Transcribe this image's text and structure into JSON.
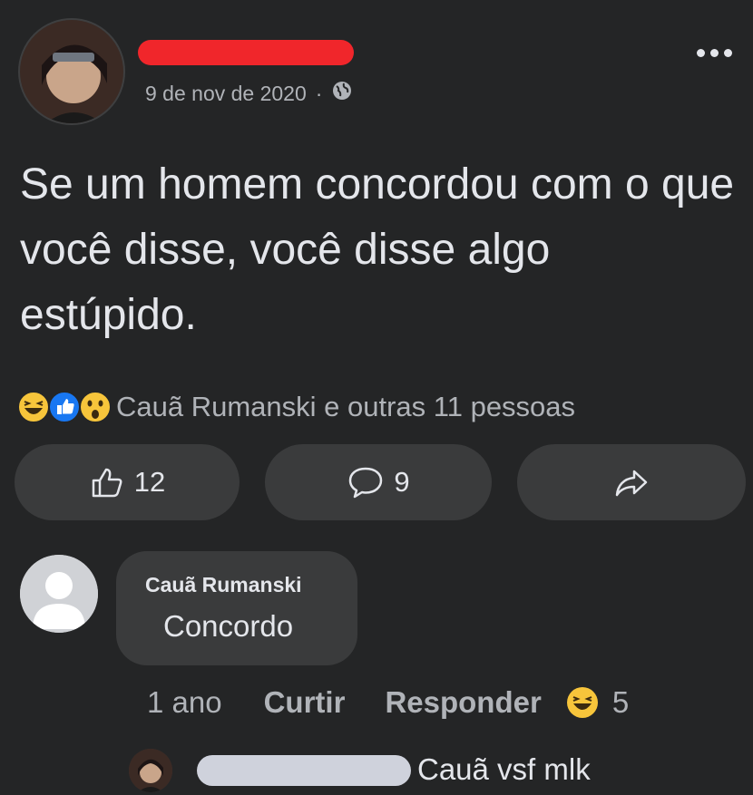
{
  "post": {
    "date": "9 de nov de 2020",
    "separator": "·",
    "privacy_icon": "globe-icon",
    "text": "Se um homem concordou com o que você disse, você disse algo estúpido."
  },
  "reactions": {
    "icons": [
      "haha-icon",
      "like-icon",
      "wow-icon"
    ],
    "summary": "Cauã Rumanski e outras 11 pessoas"
  },
  "actions": {
    "like_count": "12",
    "comment_count": "9"
  },
  "comment": {
    "author": "Cauã Rumanski",
    "text": "Concordo",
    "time": "1 ano",
    "like_label": "Curtir",
    "reply_label": "Responder",
    "reaction_count": "5"
  },
  "reply": {
    "text": "Cauã vsf mlk"
  },
  "colors": {
    "background": "#242526",
    "button": "#3a3b3c",
    "redaction_red": "#f0262b",
    "redaction_gray": "#cfd2dc"
  }
}
